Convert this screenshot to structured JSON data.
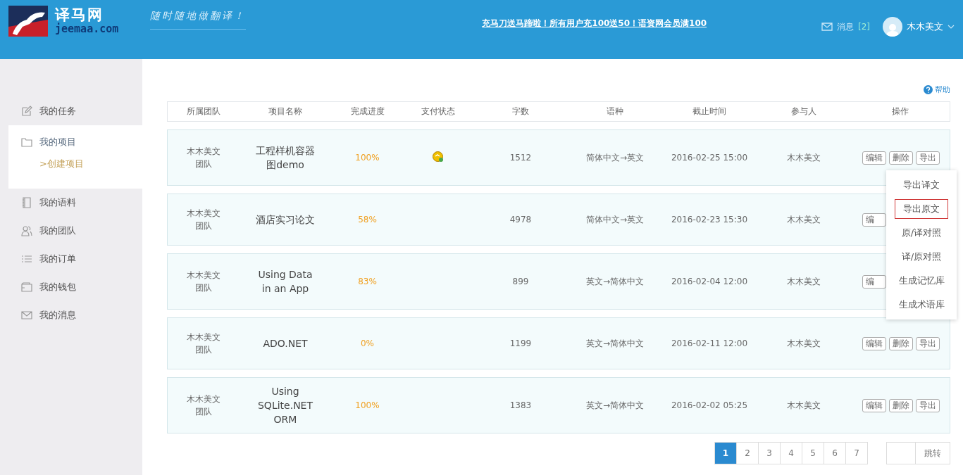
{
  "header": {
    "brand": "译马网",
    "domain": "jeemaa.com",
    "slogan": "随时随地做翻译！",
    "promo": "充马刀送马蹄啦！所有用户充100送50！语资网会员满100",
    "messages": {
      "label": "消息",
      "count": "[2]"
    },
    "user": "木木美文"
  },
  "sidebar": {
    "items": [
      {
        "label": "我的任务",
        "kind": "edit",
        "selected": false
      },
      {
        "label": "我的项目",
        "kind": "folder",
        "selected": true,
        "children": [
          {
            "label": ">创建项目"
          }
        ]
      },
      {
        "label": "我的语料",
        "kind": "book",
        "selected": false
      },
      {
        "label": "我的团队",
        "kind": "team",
        "selected": false
      },
      {
        "label": "我的订单",
        "kind": "list",
        "selected": false
      },
      {
        "label": "我的钱包",
        "kind": "wallet",
        "selected": false
      },
      {
        "label": "我的消息",
        "kind": "mail",
        "selected": false
      }
    ]
  },
  "help": "帮助",
  "table": {
    "columns": [
      "所属团队",
      "项目名称",
      "完成进度",
      "支付状态",
      "字数",
      "语种",
      "截止时间",
      "参与人",
      "操作"
    ],
    "rows": [
      {
        "team": "木木美文团队",
        "name": "工程样机容器图demo",
        "progress": "100%",
        "paid": true,
        "words": "1512",
        "language": "简体中文→英文",
        "deadline": "2016-02-25 15:00",
        "member": "木木美文",
        "actions": [
          "编辑",
          "删除",
          "导出"
        ]
      },
      {
        "team": "木木美文团队",
        "name": "酒店实习论文",
        "progress": "58%",
        "paid": false,
        "words": "4978",
        "language": "简体中文→英文",
        "deadline": "2016-02-23 15:30",
        "member": "木木美文",
        "actions": [
          "编"
        ]
      },
      {
        "team": "木木美文团队",
        "name": "Using Data in an App",
        "progress": "83%",
        "paid": false,
        "words": "899",
        "language": "英文→简体中文",
        "deadline": "2016-02-04 12:00",
        "member": "木木美文",
        "actions": [
          "编"
        ]
      },
      {
        "team": "木木美文团队",
        "name": "ADO.NET",
        "progress": "0%",
        "paid": false,
        "words": "1199",
        "language": "英文→简体中文",
        "deadline": "2016-02-11 12:00",
        "member": "木木美文",
        "actions": [
          "编辑",
          "删除",
          "导出"
        ]
      },
      {
        "team": "木木美文团队",
        "name": "Using SQLite.NET ORM",
        "progress": "100%",
        "paid": false,
        "words": "1383",
        "language": "英文→简体中文",
        "deadline": "2016-02-02 05:25",
        "member": "木木美文",
        "actions": [
          "编辑",
          "删除",
          "导出"
        ]
      }
    ]
  },
  "export_menu": {
    "items": [
      {
        "label": "导出译文",
        "selected": false
      },
      {
        "label": "导出原文",
        "selected": true
      },
      {
        "label": "原/译对照",
        "selected": false
      },
      {
        "label": "译/原对照",
        "selected": false
      },
      {
        "label": "生成记忆库",
        "selected": false
      },
      {
        "label": "生成术语库",
        "selected": false
      }
    ]
  },
  "pagination": {
    "pages": [
      {
        "label": "1",
        "selected": true
      },
      {
        "label": "2",
        "selected": false
      },
      {
        "label": "3",
        "selected": false
      },
      {
        "label": "4",
        "selected": false
      },
      {
        "label": "5",
        "selected": false
      },
      {
        "label": "6",
        "selected": false
      },
      {
        "label": "7",
        "selected": false
      }
    ],
    "jump": "跳转"
  }
}
